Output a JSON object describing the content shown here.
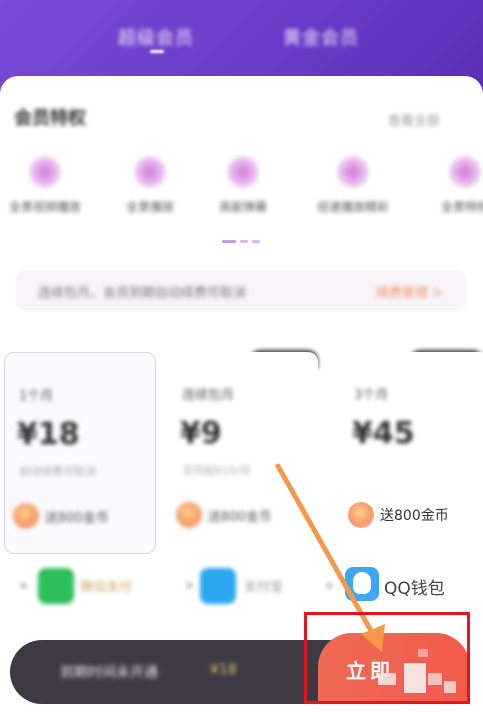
{
  "header": {
    "tabs": [
      {
        "label": "超级会员"
      },
      {
        "label": "黄金会员"
      }
    ]
  },
  "privileges": {
    "title": "会员特权",
    "more_label": "查看全部",
    "items": [
      {
        "label": "全景视频播放",
        "icon": "play-privilege-icon"
      },
      {
        "label": "全景播放",
        "icon": "panorama-icon"
      },
      {
        "label": "高能弹幕",
        "icon": "crown-icon"
      },
      {
        "label": "倍速播放精彩",
        "icon": "speed-icon"
      },
      {
        "label": "全景特权",
        "icon": "gift-privilege-icon"
      }
    ]
  },
  "notice": {
    "text": "连续包月，会员到期自动续费可取消",
    "link": "续费管理 >"
  },
  "packages": [
    {
      "name": "1个月",
      "price": "¥18",
      "sub": "自动续费可取消",
      "gift": "送800金币",
      "selected": true
    },
    {
      "name": "连续包月",
      "price": "¥9",
      "sub": "次月起¥15/月",
      "gift": "送800金币",
      "selected": false
    },
    {
      "name": "3个月",
      "price": "¥45",
      "sub": "",
      "gift": "送800金币",
      "selected": false
    }
  ],
  "payment": {
    "wechat_label": "微信支付",
    "alipay_label": "支付宝",
    "qq_label": "QQ钱包"
  },
  "bottom": {
    "summary": "到期时间未开通",
    "summary_accent": "¥18",
    "pay_button_label": "立即"
  },
  "colors": {
    "header": "#6a3cc8",
    "pay_button": "#f25a4b",
    "highlight": "#e8141b",
    "arrow": "#f39a4a"
  }
}
